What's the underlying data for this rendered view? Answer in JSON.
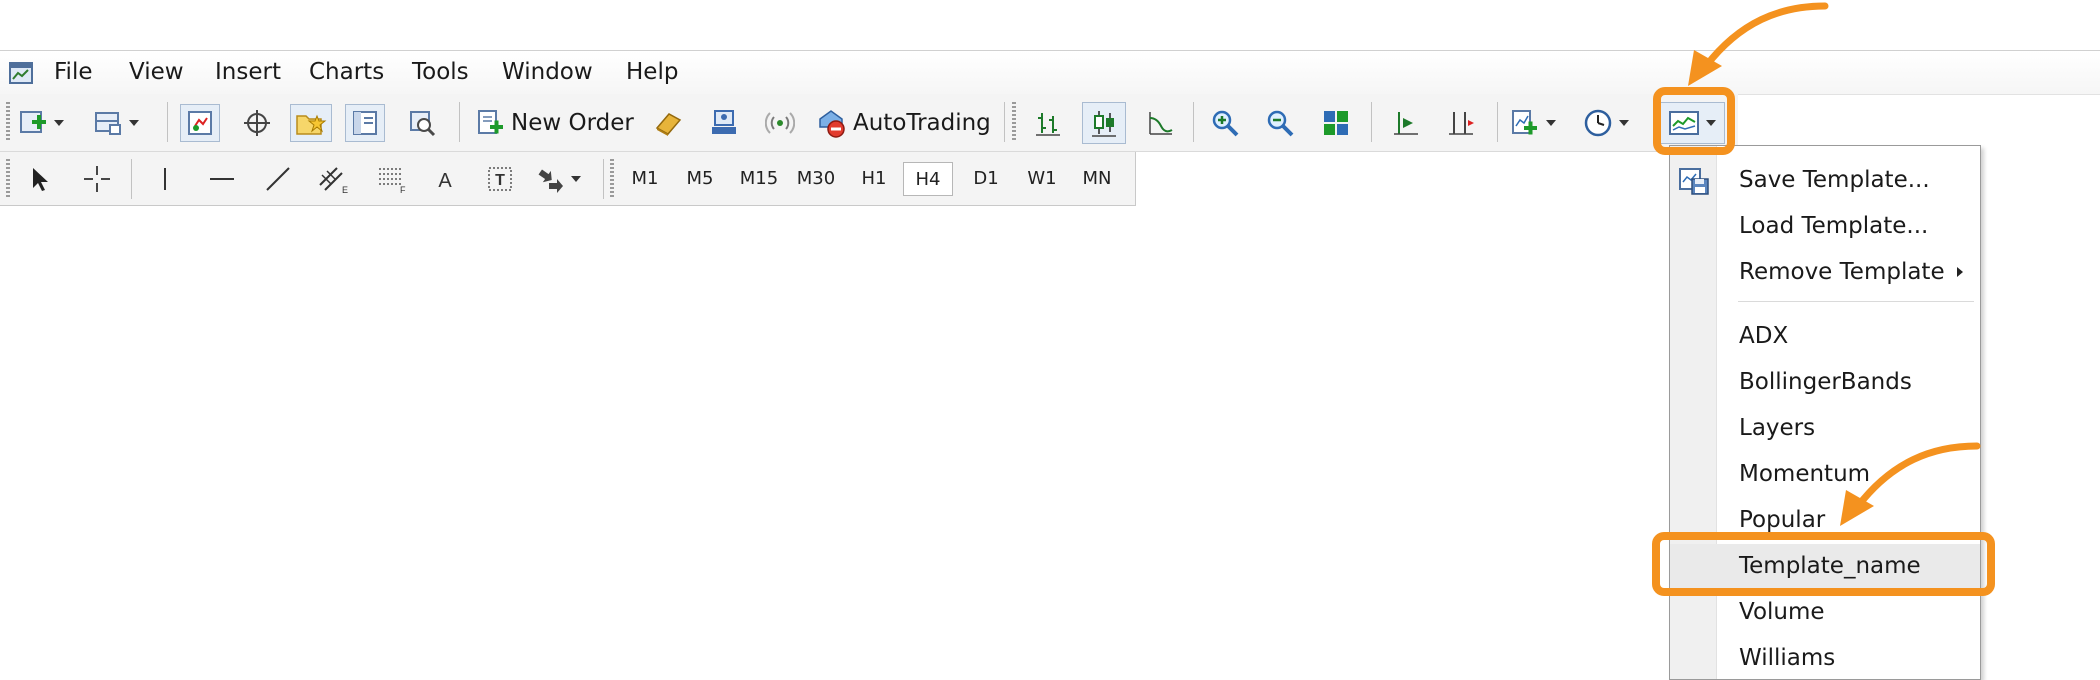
{
  "menubar": {
    "items": [
      "File",
      "View",
      "Insert",
      "Charts",
      "Tools",
      "Window",
      "Help"
    ]
  },
  "toolbar": {
    "new_order_label": "New Order",
    "autotrading_label": "AutoTrading",
    "timeframes": [
      "M1",
      "M5",
      "M15",
      "M30",
      "H1",
      "H4",
      "D1",
      "W1",
      "MN"
    ],
    "selected_timeframe": "H4"
  },
  "template_menu": {
    "save": "Save Template...",
    "load": "Load Template...",
    "remove": "Remove Template",
    "templates": [
      "ADX",
      "BollingerBands",
      "Layers",
      "Momentum",
      "Popular",
      "Template_name",
      "Volume",
      "Williams"
    ],
    "highlighted": "Template_name"
  },
  "annotation": {
    "color": "#f4921f"
  }
}
